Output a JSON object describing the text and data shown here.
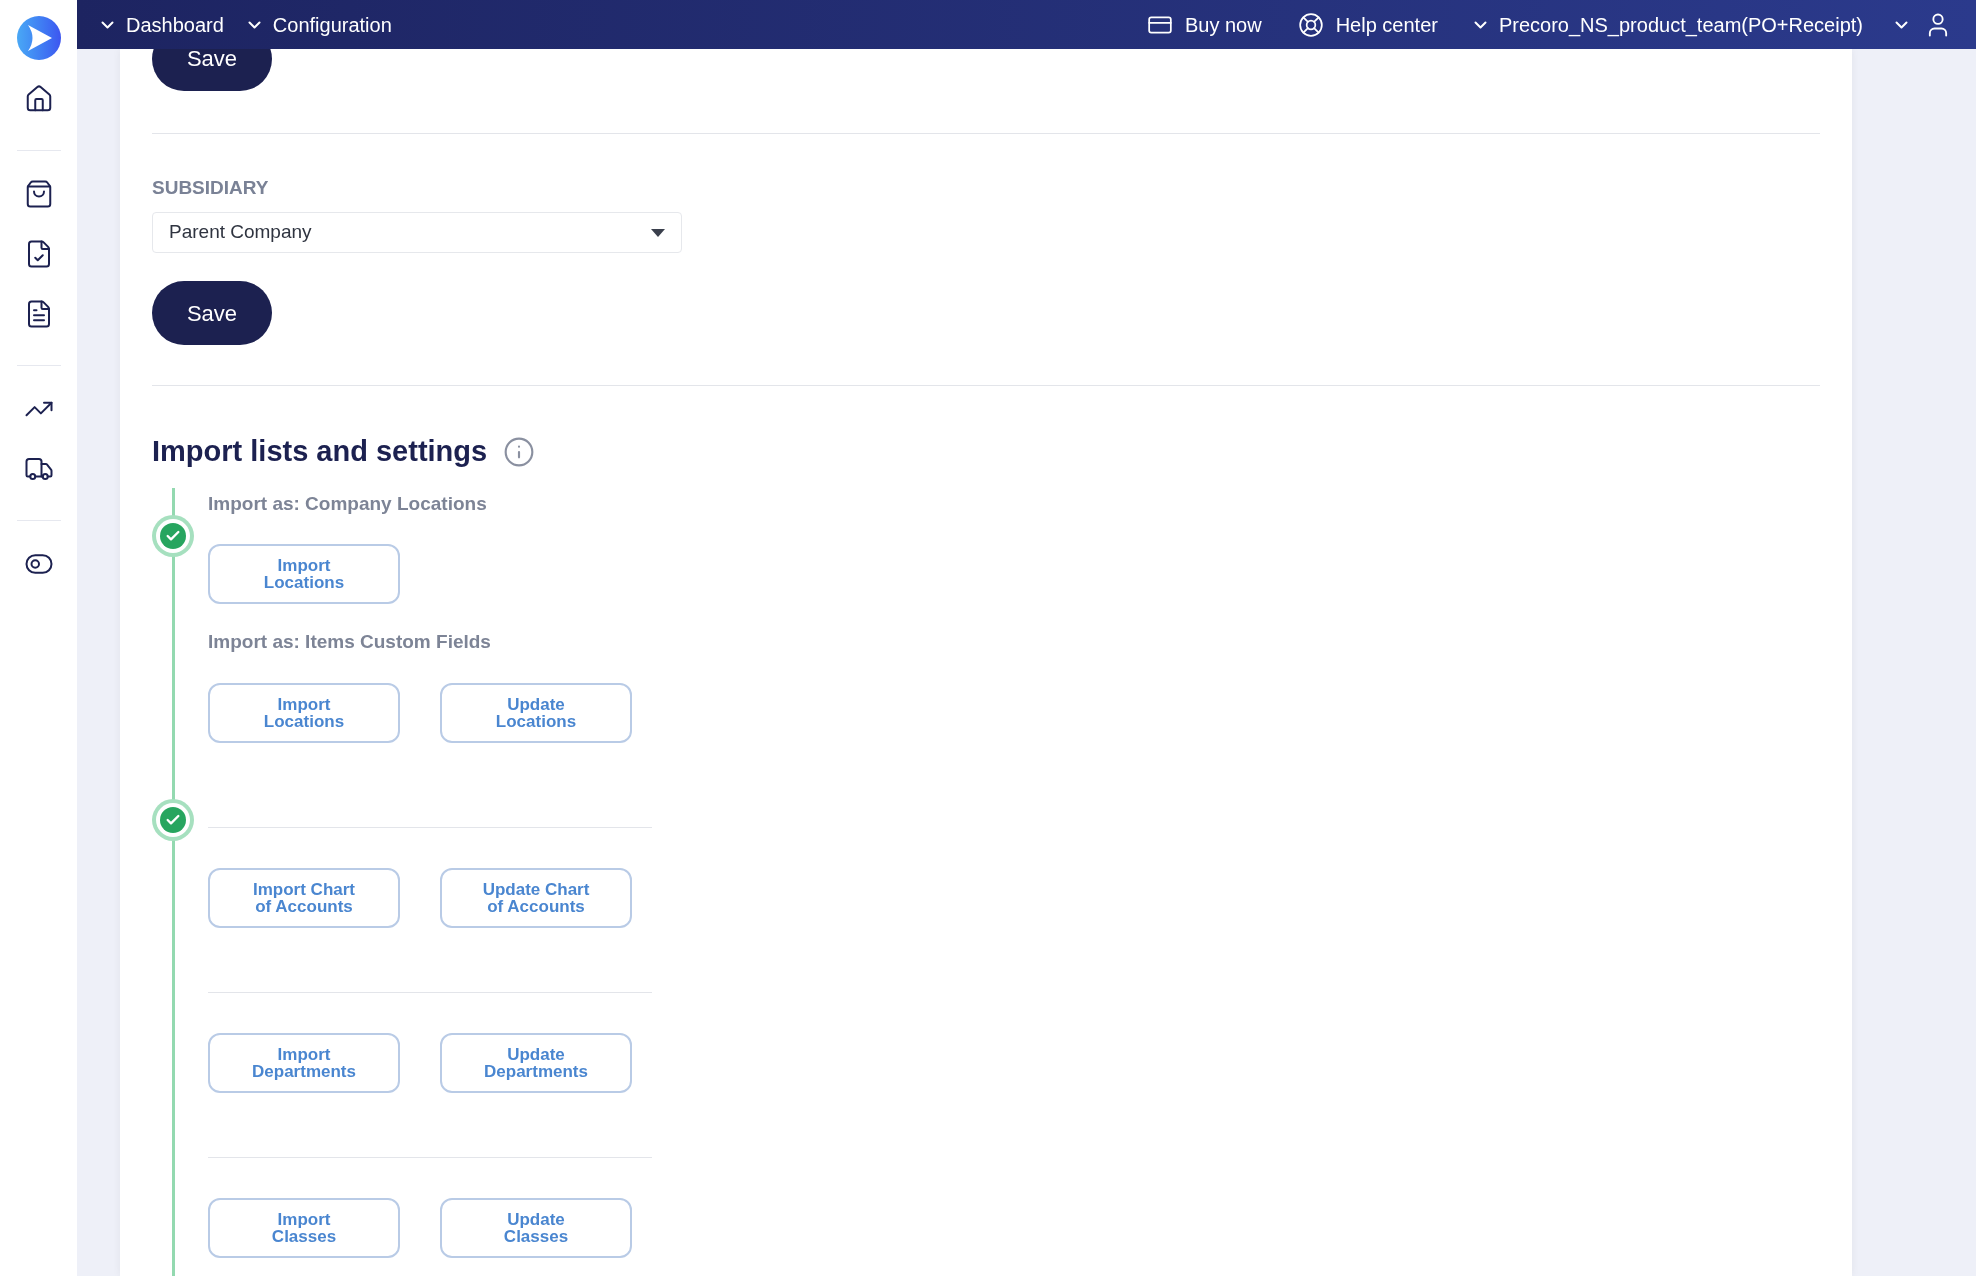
{
  "top_nav": {
    "menus": [
      {
        "label": "Dashboard"
      },
      {
        "label": "Configuration"
      }
    ],
    "links": [
      {
        "kind": "buy",
        "label": "Buy now"
      },
      {
        "kind": "help",
        "label": "Help center"
      }
    ],
    "account": {
      "label": "Precoro_NS_product_team(PO+Receipt)"
    }
  },
  "sidebar": {
    "groups": [
      [
        {
          "kind": "home"
        }
      ],
      [
        {
          "kind": "bag"
        },
        {
          "kind": "doc-check"
        },
        {
          "kind": "doc-money"
        }
      ],
      [
        {
          "kind": "chart"
        },
        {
          "kind": "truck"
        }
      ],
      [
        {
          "kind": "toggles"
        }
      ]
    ]
  },
  "top_save": {
    "label": "Save"
  },
  "subsidiary": {
    "label": "SUBSIDIARY",
    "value": "Parent Company",
    "save": "Save"
  },
  "import": {
    "title": "Import lists and settings",
    "steps": [
      {
        "completed": true,
        "groups": [
          {
            "title": "Import as: Company Locations",
            "buttons": [
              "Import Locations"
            ]
          },
          {
            "title": "Import as: Items Custom Fields",
            "buttons": [
              "Import Locations",
              "Update Locations"
            ]
          }
        ]
      },
      {
        "completed": true,
        "groups": [
          {
            "buttons": [
              "Import Chart of Accounts",
              "Update Chart of Accounts"
            ]
          },
          {
            "buttons": [
              "Import Departments",
              "Update Departments"
            ]
          },
          {
            "buttons": [
              "Import Classes",
              "Update Classes"
            ]
          }
        ]
      }
    ]
  }
}
